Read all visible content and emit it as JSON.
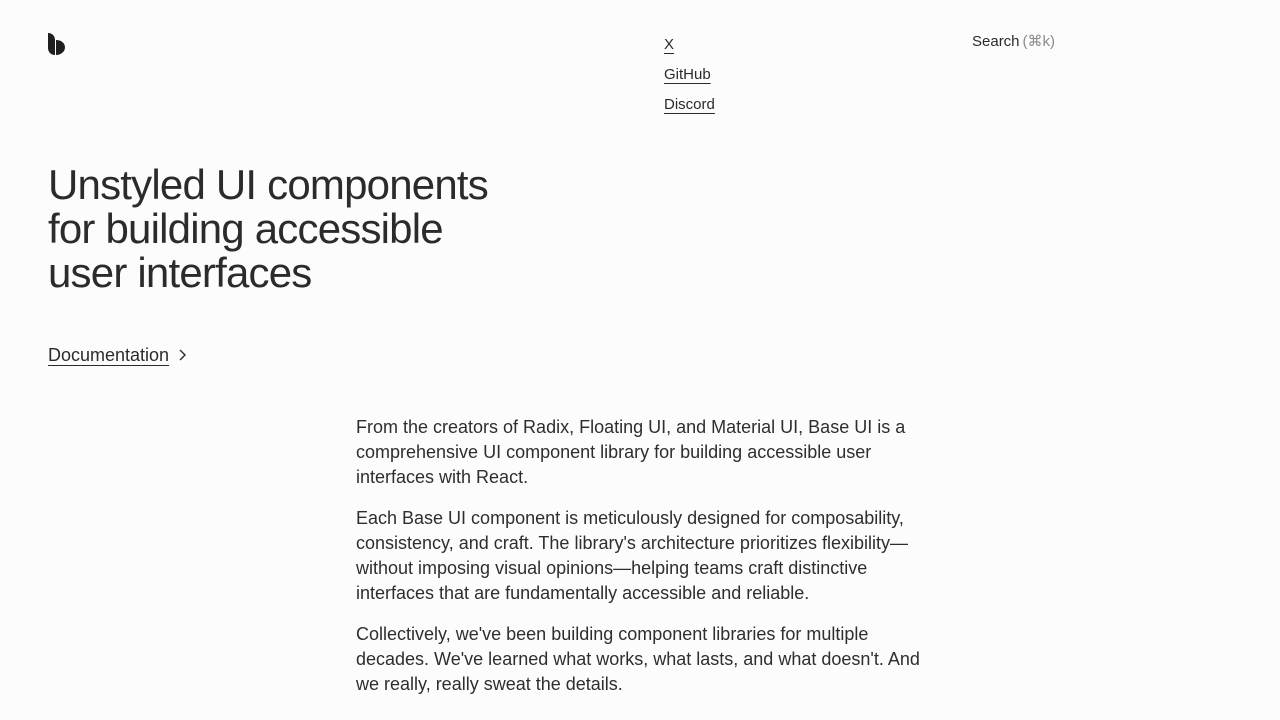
{
  "brand": {
    "logo_icon": "base-ui-logo-icon"
  },
  "nav": {
    "links": [
      {
        "label": "X"
      },
      {
        "label": "GitHub"
      },
      {
        "label": "Discord"
      }
    ]
  },
  "search": {
    "label": "Search",
    "shortcut": "(⌘k)"
  },
  "hero": {
    "title": "Unstyled UI components for building accessible user interfaces",
    "cta_label": "Documentation",
    "cta_icon": "chevron-right-icon"
  },
  "intro": {
    "paragraphs": [
      "From the creators of Radix, Floating UI, and Material UI, Base UI is a comprehensive UI component library for building accessible user interfaces with React.",
      "Each Base UI component is meticulously designed for composability, consistency, and craft. The library's architecture prioritizes flexibility—without imposing visual opinions—helping teams craft distinctive interfaces that are fundamentally accessible and reliable.",
      "Collectively, we've been building component libraries for multiple decades. We've learned what works, what lasts, and what doesn't. And we really, really sweat the details."
    ]
  },
  "colors": {
    "background": "#fcfcfc",
    "text": "#2b2b2b",
    "muted": "#8a8a8a"
  }
}
